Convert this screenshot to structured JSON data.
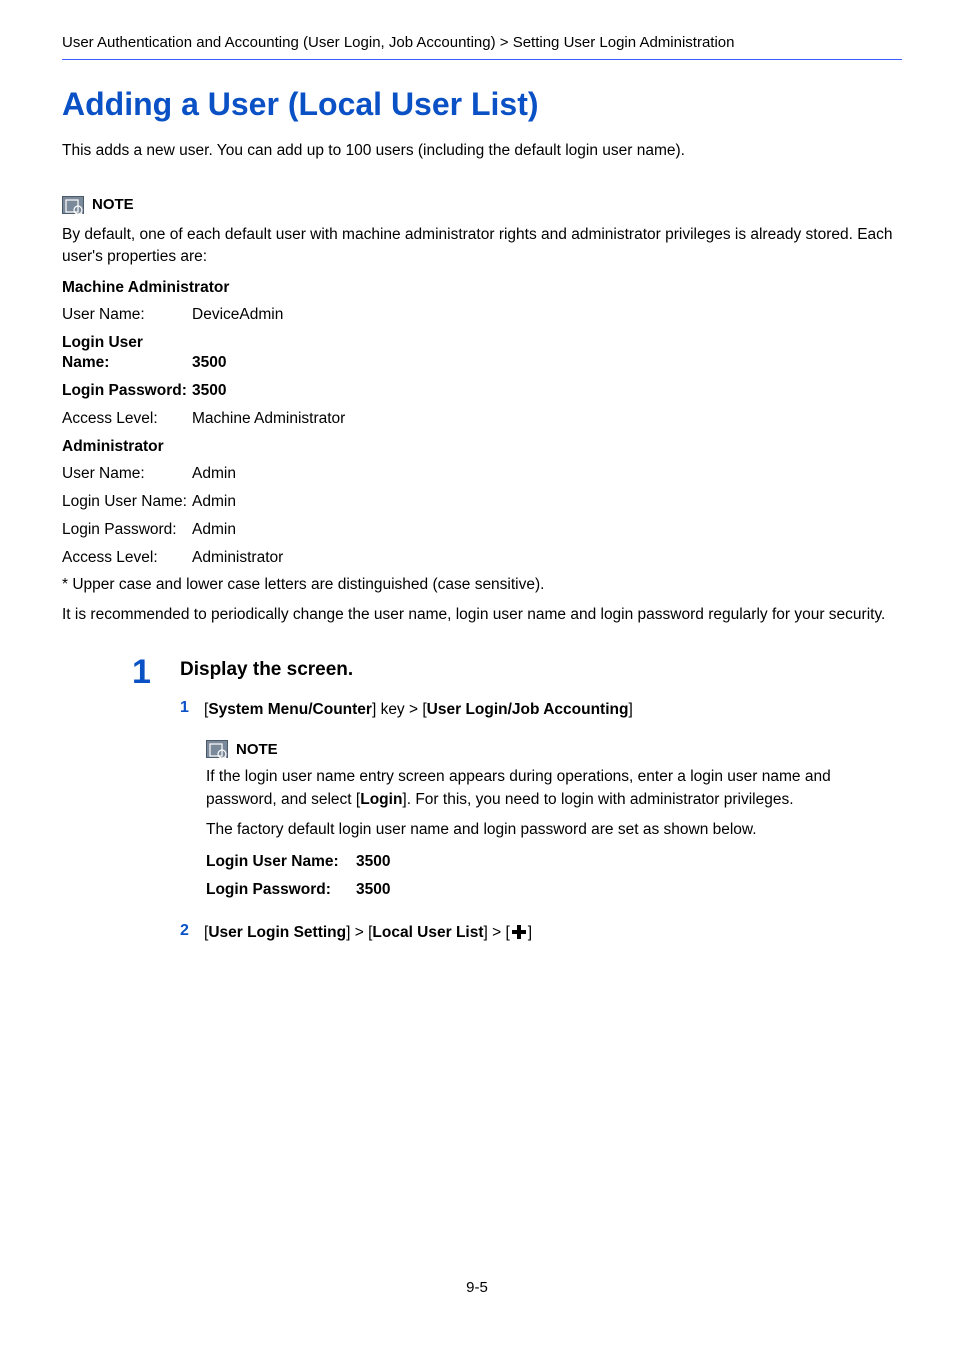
{
  "breadcrumb": "User Authentication and Accounting (User Login, Job Accounting) > Setting User Login Administration",
  "title": "Adding a User (Local User List)",
  "intro": "This adds a new user. You can add up to 100 users (including the default login user name).",
  "note_label": "NOTE",
  "note_body": "By default, one of each default user with machine administrator rights and administrator privileges is already stored. Each user's properties are:",
  "machine_admin_title": "Machine Administrator",
  "ma": {
    "user_name_k": "User Name:",
    "user_name_v": "DeviceAdmin",
    "login_user_k": "Login User Name:",
    "login_user_v": "3500",
    "login_pass_k": "Login Password:",
    "login_pass_v": "3500",
    "access_k": "Access Level:",
    "access_v": "Machine Administrator"
  },
  "admin_title": "Administrator",
  "ad": {
    "user_name_k": "User Name:",
    "user_name_v": "Admin",
    "login_user_k": "Login User Name:",
    "login_user_v": "Admin",
    "login_pass_k": "Login Password:",
    "login_pass_v": "Admin",
    "access_k": "Access Level:",
    "access_v": "Administrator"
  },
  "aster": "* Upper case and lower case letters are distinguished (case sensitive).",
  "recommend": "It is recommended to periodically change the user name, login user name and login password regularly for your security.",
  "step1": {
    "num": "1",
    "title": "Display the screen.",
    "sub1_num": "1",
    "sub1_before": "[",
    "sub1_b1": "System Menu/Counter",
    "sub1_mid": "] key > [",
    "sub1_b2": "User Login/Job Accounting",
    "sub1_after": "]",
    "note_label": "NOTE",
    "note1": "If the login user name entry screen appears during operations, enter a login user name and password, and select [",
    "note1_b": "Login",
    "note1_after": "]. For this, you need to login with administrator privileges.",
    "note2": "The factory default login user name and login password are set as shown below.",
    "login_user_k": "Login User Name:",
    "login_user_v": "3500",
    "login_pass_k": "Login Password:",
    "login_pass_v": "3500",
    "sub2_num": "2",
    "sub2_before": "[",
    "sub2_b1": "User Login Setting",
    "sub2_mid1": "] > [",
    "sub2_b2": "Local User List",
    "sub2_mid2": "] > [",
    "sub2_after": "]"
  },
  "page_number": "9-5"
}
